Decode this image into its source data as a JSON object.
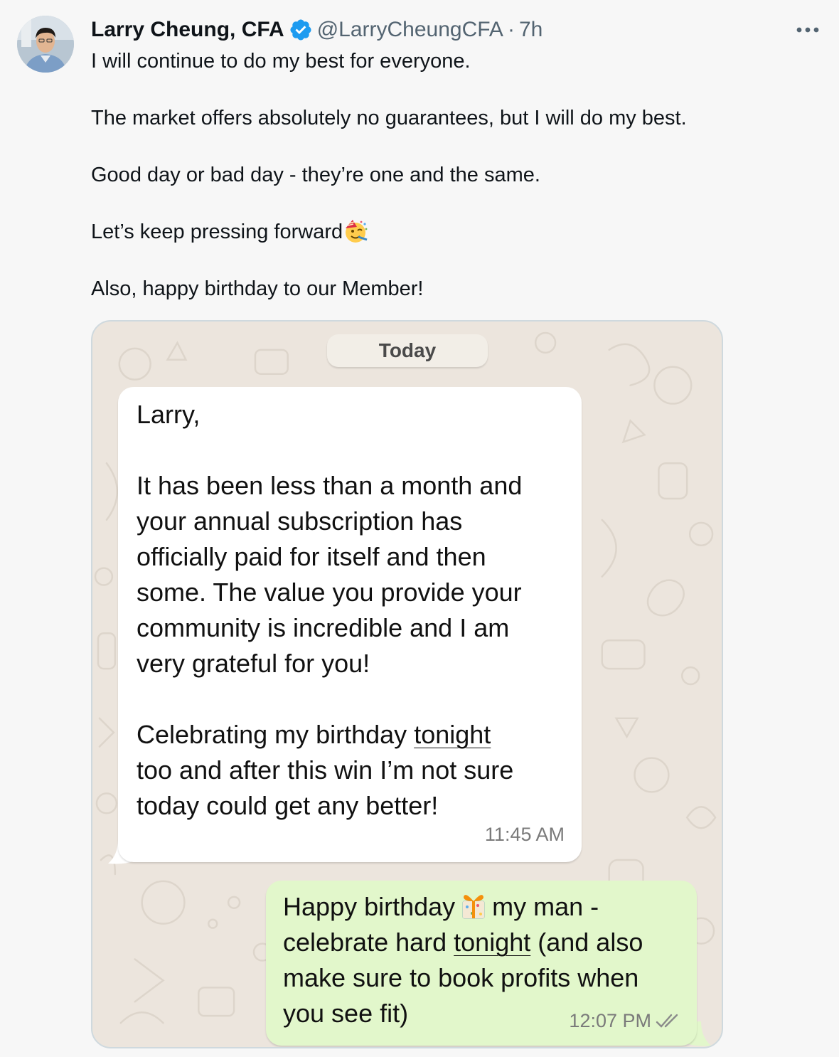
{
  "author": {
    "name": "Larry Cheung, CFA",
    "handle": "@LarryCheungCFA",
    "separator": "·",
    "time": "7h",
    "verified": true,
    "verified_color": "#1d9bf0"
  },
  "icons": {
    "more": "more-horizontal-icon",
    "verified": "verified-badge-icon",
    "emoji": "partying-face-emoji",
    "gift": "wrapped-gift-emoji",
    "read_receipt": "double-check-icon"
  },
  "tweet": {
    "lines": [
      "I will continue to do my best for everyone.",
      "The market offers absolutely no guarantees, but I will do my best.",
      "Good day or bad day - they’re one and the same.",
      "Let’s keep pressing forward",
      "Also, happy birthday to our Member!"
    ]
  },
  "chat": {
    "date_label": "Today",
    "incoming": {
      "greeting": "Larry,",
      "para1": [
        "It has been less than a month and",
        "your annual subscription has",
        "officially paid for itself and then",
        "some. The value you provide your",
        "community is incredible and I am",
        "very grateful for you!"
      ],
      "para2_line1_pre": "Celebrating my birthday ",
      "para2_line1_link": "tonight",
      "para2_line2": "too and after this win I’m not sure",
      "para2_line3": "today could get any better!",
      "time": "11:45 AM"
    },
    "outgoing": {
      "line1_pre": "Happy birthday",
      "line1_post": "my man -",
      "line2_pre": "celebrate hard ",
      "line2_link": "tonight",
      "line2_post": " (and also",
      "line3": "make sure to book profits when",
      "line4": "you see fit)",
      "time": "12:07 PM"
    },
    "colors": {
      "wallpaper": "#ece5dd",
      "incoming_bubble": "#ffffff",
      "outgoing_bubble": "#e2f7cb"
    }
  }
}
